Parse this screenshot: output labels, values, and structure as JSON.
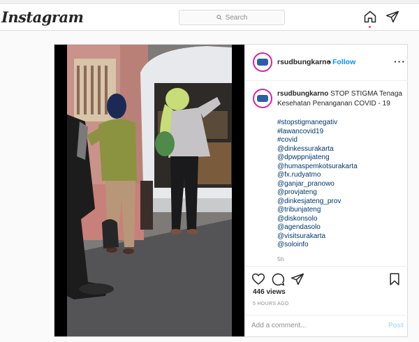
{
  "app": {
    "logo_text": "Instagram"
  },
  "search": {
    "placeholder": "Search"
  },
  "nav": {
    "icons": [
      "home-icon",
      "direct-message-icon"
    ],
    "active_dot_color": "#ed4956"
  },
  "post": {
    "username": "rsudbungkarno",
    "separator": "•",
    "follow_label": "Follow",
    "caption": "STOP STIGMA Tenaga Kesehatan Penanganan COVID - 19",
    "hashtags": [
      "#stopstigmanegativ",
      "#lawancovid19",
      "#covid",
      "@dinkessurakarta",
      "@dpwppnijateng",
      "@humaspemkotsurakarta",
      "@fx.rudyatmo",
      "@ganjar_pranowo",
      "@provjateng",
      "@dinkesjateng_prov",
      "@tribunjateng",
      "@diskonsolo",
      "@agendasolo",
      "@visitsurakarta",
      "@soloinfo"
    ],
    "relative_time": "5h",
    "views": "446 views",
    "posted_ago": "5 HOURS AGO",
    "comment_placeholder": "Add a comment...",
    "post_button_label": "Post"
  },
  "colors": {
    "link": "#00376b",
    "accent": "#0095f6",
    "muted": "#8e8e8e",
    "border": "#dbdbdb"
  }
}
